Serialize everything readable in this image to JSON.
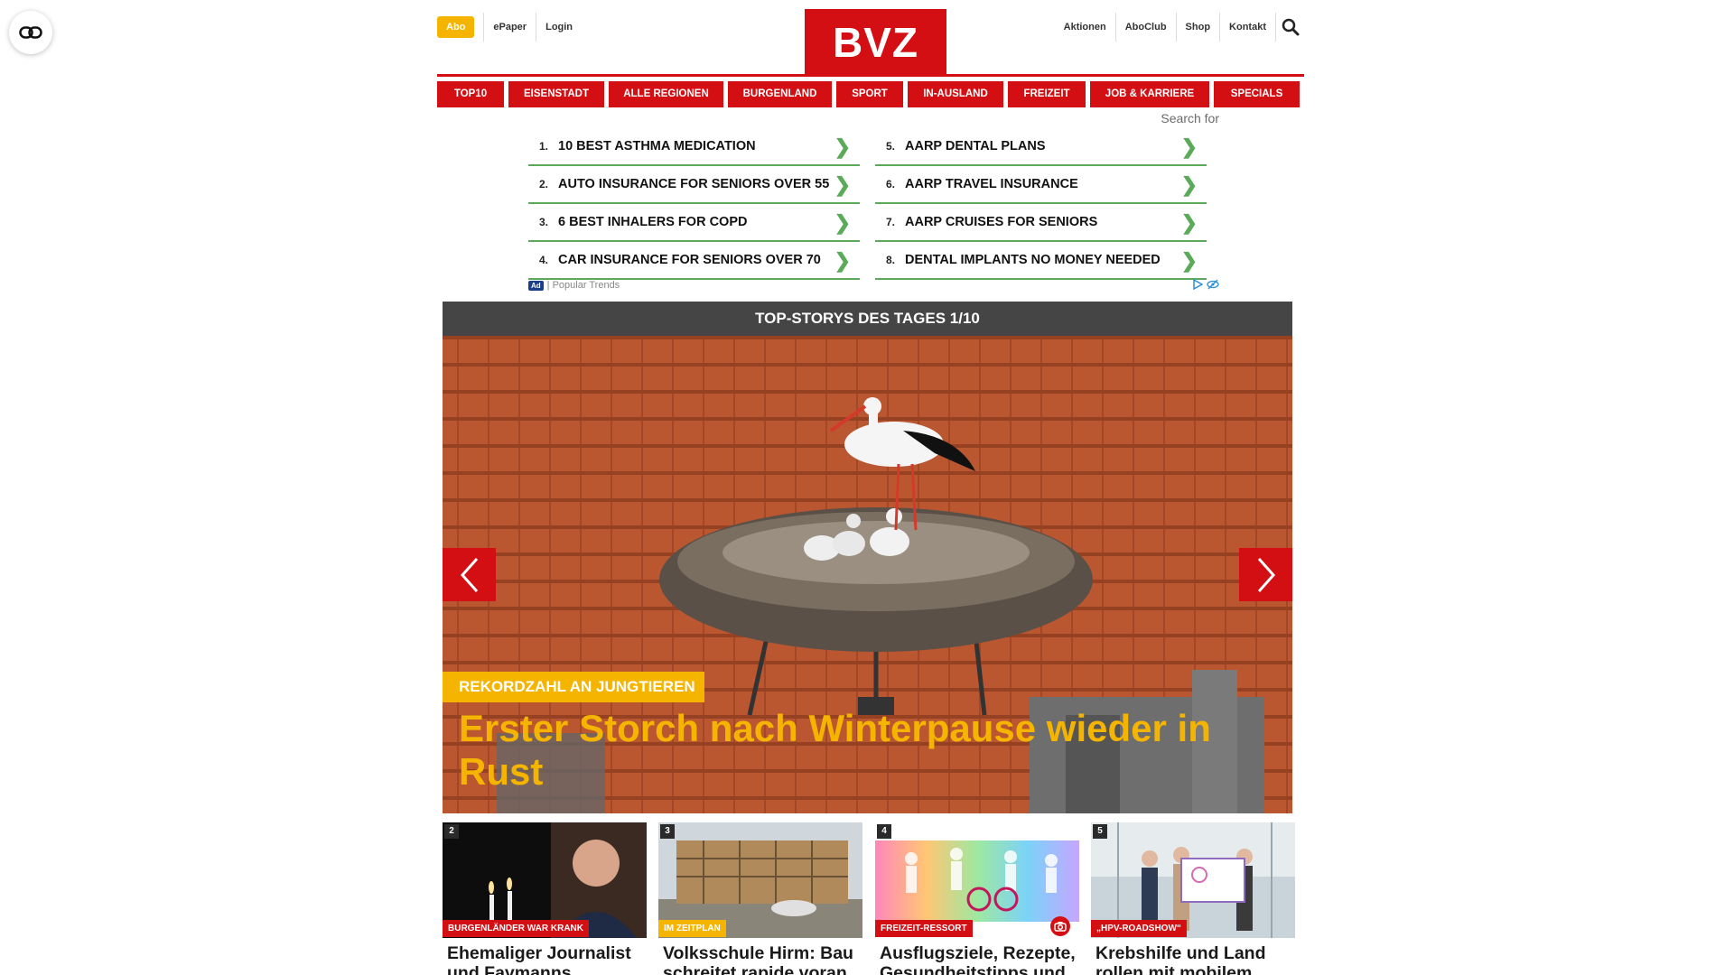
{
  "header": {
    "abo_label": "Abo",
    "left_links": [
      "ePaper",
      "Login"
    ],
    "right_links": [
      "Aktionen",
      "AboClub",
      "Shop",
      "Kontakt"
    ],
    "logo_text": "BVZ"
  },
  "nav": [
    "TOP10",
    "EISENSTADT",
    "ALLE REGIONEN",
    "BURGENLAND",
    "SPORT",
    "IN-AUSLAND",
    "FREIZEIT",
    "JOB & KARRIERE",
    "SPECIALS"
  ],
  "ad": {
    "search_label": "Search for",
    "items": [
      {
        "num": "1.",
        "text": "10 BEST ASTHMA MEDICATION"
      },
      {
        "num": "5.",
        "text": "AARP DENTAL PLANS"
      },
      {
        "num": "2.",
        "text": "AUTO INSURANCE FOR SENIORS OVER 55"
      },
      {
        "num": "6.",
        "text": "AARP TRAVEL INSURANCE"
      },
      {
        "num": "3.",
        "text": "6 BEST INHALERS FOR COPD"
      },
      {
        "num": "7.",
        "text": "AARP CRUISES FOR SENIORS"
      },
      {
        "num": "4.",
        "text": "CAR INSURANCE FOR SENIORS OVER 70"
      },
      {
        "num": "8.",
        "text": "DENTAL IMPLANTS NO MONEY NEEDED"
      }
    ],
    "badge": "Ad",
    "footer_text": "| Popular Trends",
    "chevron": "❯"
  },
  "top_stories": {
    "heading": "TOP-STORYS DES TAGES 1/10",
    "kicker": "REKORDZAHL AN JUNGTIEREN",
    "title": "Erster Storch nach Winterpause wieder in Rust"
  },
  "cards": [
    {
      "rank": "2",
      "tag": "BURGENLÄNDER WAR KRANK",
      "title": "Ehemaliger Journalist und Faymanns Sprecher"
    },
    {
      "rank": "3",
      "tag": "IM ZEITPLAN",
      "title": "Volksschule Hirm: Bau schreitet rapide voran"
    },
    {
      "rank": "4",
      "tag": "FREIZEIT-RESSORT",
      "title": "Ausflugsziele, Rezepte, Gesundheitstipps und"
    },
    {
      "rank": "5",
      "tag": "„HPV-ROADSHOW“",
      "title": "Krebshilfe und Land rollen mit mobilem"
    }
  ],
  "colors": {
    "brand_red": "#d40f14",
    "accent_yellow": "#f5b400",
    "ad_green": "#5aaa5a"
  }
}
